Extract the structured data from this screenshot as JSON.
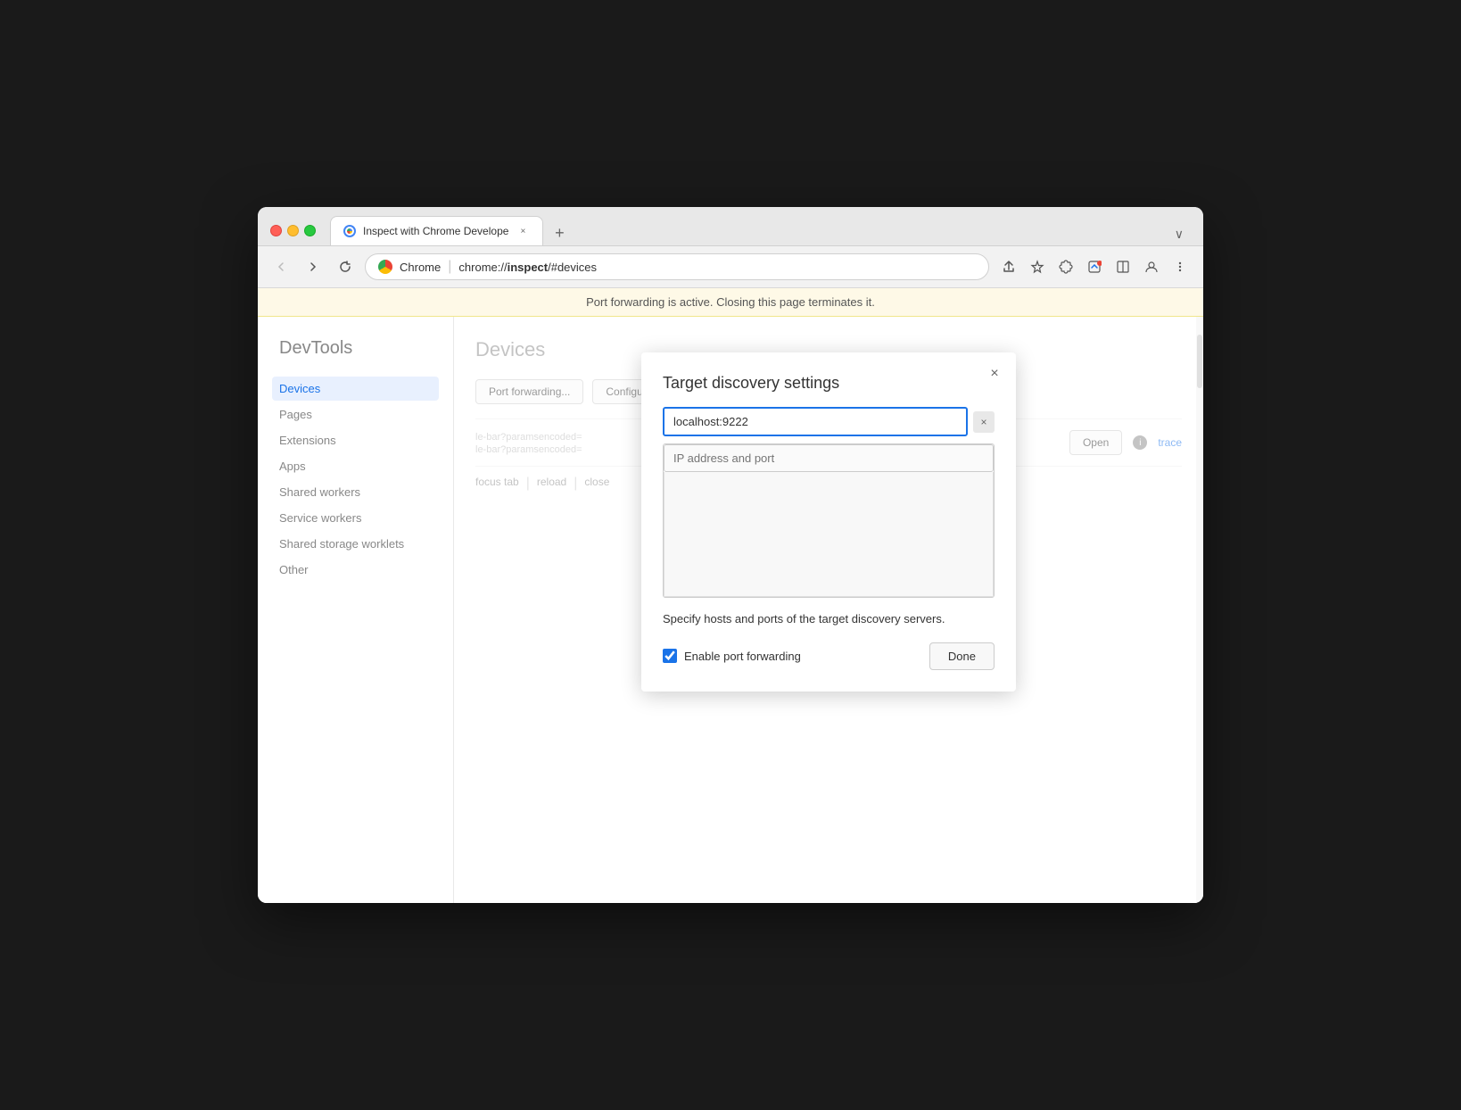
{
  "browser": {
    "tab_title": "Inspect with Chrome Develope",
    "tab_close": "×",
    "new_tab": "+",
    "overflow": "∨",
    "back_btn": "←",
    "forward_btn": "→",
    "reload_btn": "↺",
    "address_scheme": "Chrome",
    "address_url": "chrome://inspect/#devices",
    "address_bold": "inspect",
    "share_icon": "⬆",
    "bookmark_icon": "☆",
    "extensions_icon": "⬡",
    "devtools_icon": "🔧",
    "sidebar_icon": "▣",
    "profile_icon": "👤",
    "menu_icon": "⋮"
  },
  "info_bar": {
    "message": "Port forwarding is active. Closing this page terminates it."
  },
  "sidebar": {
    "title": "DevTools",
    "items": [
      {
        "label": "Devices",
        "active": true
      },
      {
        "label": "Pages",
        "active": false
      },
      {
        "label": "Extensions",
        "active": false
      },
      {
        "label": "Apps",
        "active": false
      },
      {
        "label": "Shared workers",
        "active": false
      },
      {
        "label": "Service workers",
        "active": false
      },
      {
        "label": "Shared storage worklets",
        "active": false
      },
      {
        "label": "Other",
        "active": false
      }
    ]
  },
  "main": {
    "title": "Devices",
    "port_forwarding_btn": "Port forwarding...",
    "configure_btn": "Configure...",
    "open_btn": "Open",
    "trace_label": "trace",
    "url_text1": "le-bar?paramsencoded=",
    "url_text2": "le-bar?paramsencoded=",
    "bottom_actions": [
      "focus tab",
      "reload",
      "close"
    ]
  },
  "modal": {
    "title": "Target discovery settings",
    "close_btn": "×",
    "host_value": "localhost:9222",
    "host_clear": "×",
    "ip_placeholder": "IP address and port",
    "description": "Specify hosts and ports of the target discovery servers.",
    "enable_port_forwarding_label": "Enable port forwarding",
    "enable_port_forwarding_checked": true,
    "done_btn": "Done"
  }
}
